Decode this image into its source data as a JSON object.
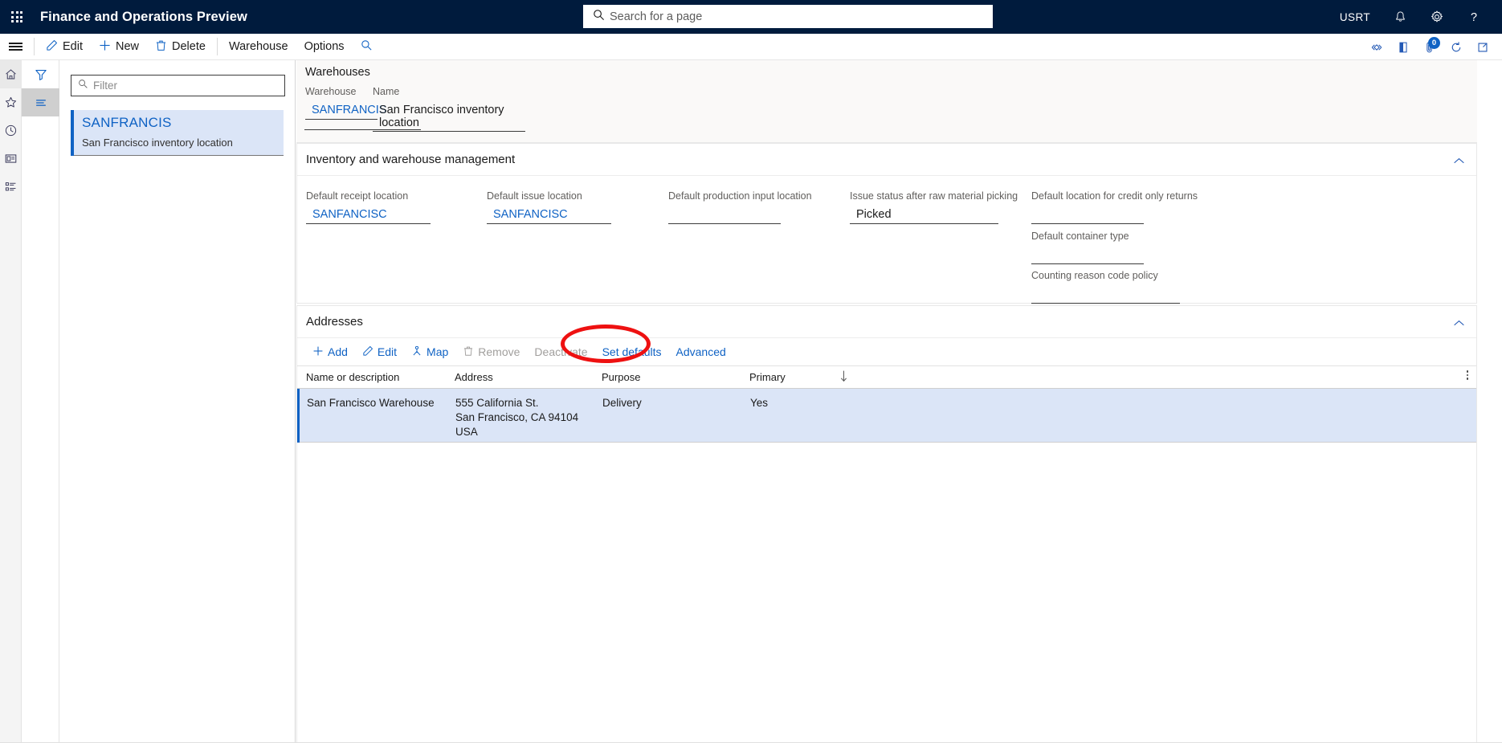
{
  "header": {
    "app_title": "Finance and Operations Preview",
    "waffle_icon": "app-launcher-icon",
    "search": {
      "placeholder": "Search for a page",
      "value": "",
      "icon": "search-icon"
    },
    "user_initials": "USRT",
    "icons": [
      {
        "name": "notifications-bell-icon",
        "glyph": "bell"
      },
      {
        "name": "settings-gear-icon",
        "glyph": "gear"
      },
      {
        "name": "help-question-icon",
        "glyph": "question"
      }
    ]
  },
  "commandbar": {
    "menu_icon": "hamburger-menu-icon",
    "buttons": [
      {
        "name": "edit-button",
        "label": "Edit",
        "icon": "pencil-icon"
      },
      {
        "name": "new-button",
        "label": "New",
        "icon": "plus-icon"
      },
      {
        "name": "delete-button",
        "label": "Delete",
        "icon": "trash-icon"
      },
      {
        "name": "warehouse-menu",
        "label": "Warehouse",
        "icon": ""
      },
      {
        "name": "options-menu",
        "label": "Options",
        "icon": ""
      }
    ],
    "search_icon": "search-icon",
    "right_icons": [
      {
        "name": "share-diamond-icon",
        "badge": ""
      },
      {
        "name": "office-integration-icon",
        "badge": ""
      },
      {
        "name": "attachments-icon",
        "badge": "0"
      },
      {
        "name": "refresh-icon",
        "badge": ""
      },
      {
        "name": "open-in-new-window-icon",
        "badge": ""
      }
    ]
  },
  "rail": {
    "items": [
      {
        "name": "sidebar-home-icon",
        "label": "Home"
      },
      {
        "name": "sidebar-favorites-icon",
        "label": "Favorites"
      },
      {
        "name": "sidebar-recent-icon",
        "label": "Recent"
      },
      {
        "name": "sidebar-workspaces-icon",
        "label": "Workspaces"
      },
      {
        "name": "sidebar-modules-icon",
        "label": "Modules"
      }
    ]
  },
  "filterpane": {
    "icons": [
      {
        "name": "filter-funnel-icon",
        "active": false
      },
      {
        "name": "list-view-icon",
        "active": true
      }
    ],
    "filter": {
      "placeholder": "Filter",
      "value": "",
      "icon": "search-icon"
    },
    "list": [
      {
        "name": "warehouse-list-item",
        "title": "SANFRANCIS",
        "subtitle": "San Francisco inventory location",
        "selected": true
      }
    ]
  },
  "main": {
    "header_card": {
      "title": "Warehouses",
      "fields": [
        {
          "name": "warehouse-field",
          "label": "Warehouse",
          "value": "SANFRANCIS",
          "style": "link"
        },
        {
          "name": "name-field",
          "label": "Name",
          "value": "San Francisco inventory location",
          "style": "text"
        }
      ]
    },
    "sections": [
      {
        "name": "inventory-and-warehouse-management-section",
        "title": "Inventory and warehouse management",
        "collapse_icon": "chevron-up-icon",
        "fields": [
          {
            "name": "default-receipt-location-field",
            "label": "Default receipt location",
            "value": "SANFANCISC",
            "style": "link"
          },
          {
            "name": "default-issue-location-field",
            "label": "Default issue location",
            "value": "SANFANCISC",
            "style": "link"
          },
          {
            "name": "default-production-input-location-field",
            "label": "Default production input location",
            "value": "",
            "style": "text"
          },
          {
            "name": "issue-status-after-raw-material-picking-field",
            "label": "Issue status after raw material picking",
            "value": "Picked",
            "style": "text"
          },
          {
            "name": "default-location-for-credit-only-returns-field",
            "label": "Default location for credit only returns",
            "value": "",
            "style": "text"
          },
          {
            "name": "default-container-type-field",
            "label": "Default container type",
            "value": "",
            "style": "text"
          },
          {
            "name": "counting-reason-code-policy-field",
            "label": "Counting reason code policy",
            "value": "",
            "style": "text"
          }
        ]
      },
      {
        "name": "addresses-section",
        "title": "Addresses",
        "collapse_icon": "chevron-up-icon",
        "toolbar": [
          {
            "name": "address-add-button",
            "label": "Add",
            "icon": "plus-icon",
            "disabled": false
          },
          {
            "name": "address-edit-button",
            "label": "Edit",
            "icon": "pencil-icon",
            "disabled": false
          },
          {
            "name": "address-map-button",
            "label": "Map",
            "icon": "map-pin-icon",
            "disabled": false
          },
          {
            "name": "address-remove-button",
            "label": "Remove",
            "icon": "trash-icon",
            "disabled": true
          },
          {
            "name": "address-deactivate-button",
            "label": "Deactivate",
            "icon": "",
            "disabled": true
          },
          {
            "name": "address-set-defaults-button",
            "label": "Set defaults",
            "icon": "",
            "disabled": false
          },
          {
            "name": "address-advanced-button",
            "label": "Advanced",
            "icon": "",
            "disabled": false
          }
        ],
        "grid": {
          "columns": [
            {
              "name": "column-name-or-description",
              "label": "Name or description"
            },
            {
              "name": "column-address",
              "label": "Address"
            },
            {
              "name": "column-purpose",
              "label": "Purpose"
            },
            {
              "name": "column-primary",
              "label": "Primary"
            }
          ],
          "sort_icon": "sort-descending-arrow-icon",
          "more_icon": "grid-options-ellipsis-icon",
          "rows": [
            {
              "name_or_description": "San Francisco Warehouse",
              "address_line1": "555 California St.",
              "address_line2": "San Francisco, CA 94104",
              "address_line3": "USA",
              "purpose": "Delivery",
              "primary": "Yes",
              "selected": true
            }
          ]
        }
      }
    ]
  },
  "annotation": {
    "name": "advanced-button-highlight",
    "shape": "ellipse",
    "color": "#ee1111",
    "target": "Advanced"
  }
}
